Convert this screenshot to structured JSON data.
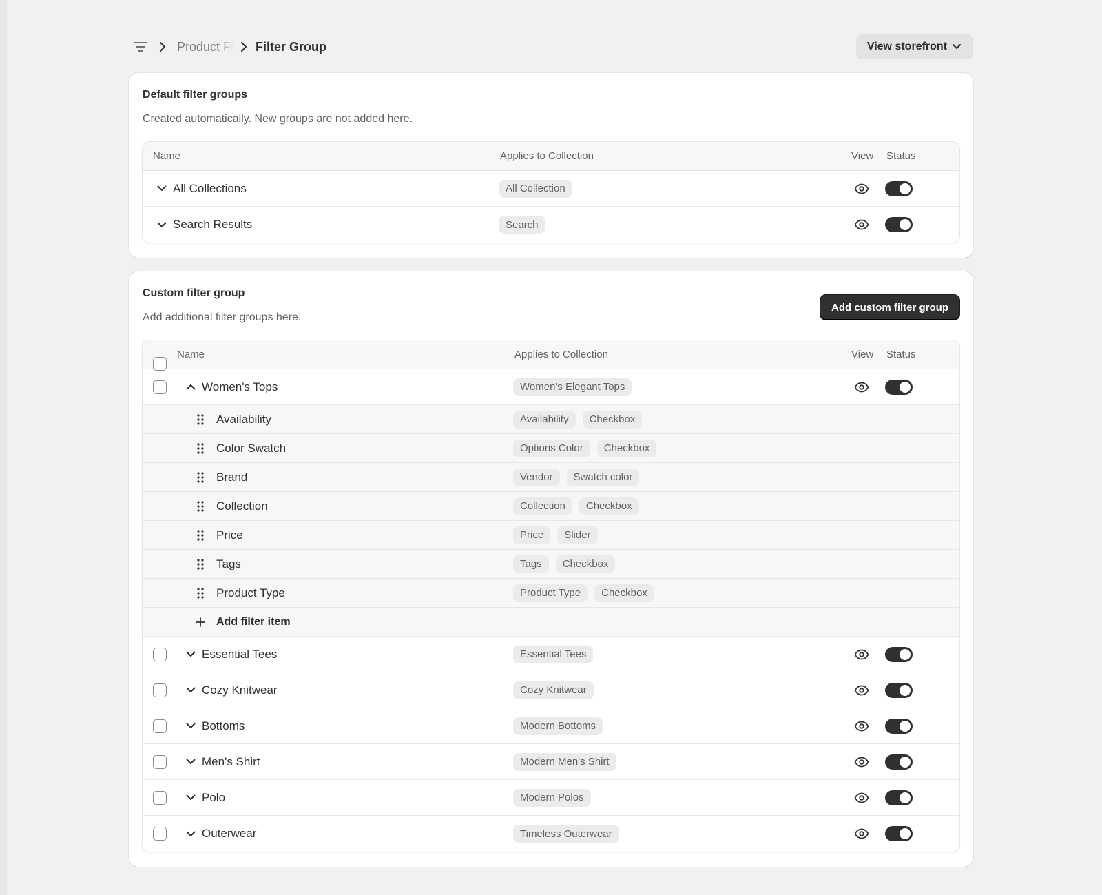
{
  "breadcrumb": {
    "previous": "Product Filters",
    "current": "Filter Group",
    "icon": "filter-lines-icon"
  },
  "header": {
    "storefront_label": "View storefront"
  },
  "default_groups": {
    "title": "Default filter groups",
    "subtitle": "Created automatically. New groups are not added here.",
    "columns": {
      "name": "Name",
      "applies": "Applies to Collection",
      "view": "View",
      "status": "Status"
    },
    "rows": [
      {
        "name": "All Collections",
        "collection": "All Collection",
        "enabled": true
      },
      {
        "name": "Search Results",
        "collection": "Search",
        "enabled": true
      }
    ]
  },
  "custom_groups": {
    "title": "Custom filter group",
    "subtitle": "Add additional filter groups here.",
    "add_button": "Add custom filter group",
    "columns": {
      "name": "Name",
      "applies": "Applies to Collection",
      "view": "View",
      "status": "Status"
    },
    "expanded": {
      "name": "Women's Tops",
      "collection": "Women's Elegant Tops",
      "enabled": true,
      "items": [
        {
          "name": "Availability",
          "source": "Availability",
          "display": "Checkbox"
        },
        {
          "name": "Color Swatch",
          "source": "Options Color",
          "display": "Checkbox"
        },
        {
          "name": "Brand",
          "source": "Vendor",
          "display": "Swatch color"
        },
        {
          "name": "Collection",
          "source": "Collection",
          "display": "Checkbox"
        },
        {
          "name": "Price",
          "source": "Price",
          "display": "Slider"
        },
        {
          "name": "Tags",
          "source": "Tags",
          "display": "Checkbox"
        },
        {
          "name": "Product Type",
          "source": "Product Type",
          "display": "Checkbox"
        }
      ],
      "add_item_label": "Add filter item"
    },
    "rows": [
      {
        "name": "Essential Tees",
        "collection": "Essential Tees",
        "enabled": true
      },
      {
        "name": "Cozy Knitwear",
        "collection": "Cozy Knitwear",
        "enabled": true
      },
      {
        "name": "Bottoms",
        "collection": "Modern Bottoms",
        "enabled": true
      },
      {
        "name": "Men's Shirt",
        "collection": "Modern Men's Shirt",
        "enabled": true
      },
      {
        "name": "Polo",
        "collection": "Modern Polos",
        "enabled": true
      },
      {
        "name": "Outerwear",
        "collection": "Timeless Outerwear",
        "enabled": true
      }
    ]
  },
  "colors": {
    "background": "#f1f1f1",
    "primary_button": "#303030",
    "toggle_on": "#303030",
    "tag_bg": "#ebebeb"
  }
}
